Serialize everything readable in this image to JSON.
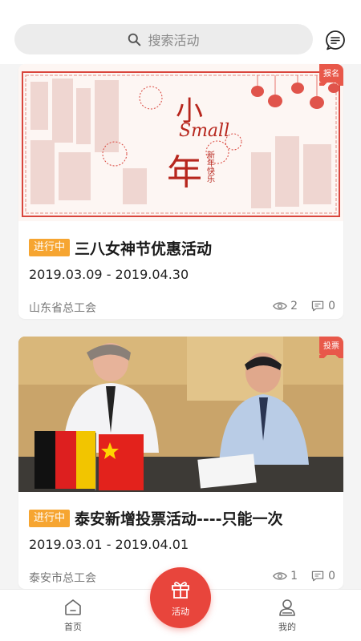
{
  "search": {
    "placeholder": "搜索活动"
  },
  "cards": [
    {
      "corner_tag": "报名",
      "status": "进行中",
      "title": "三八女神节优惠活动",
      "date_range": "2019.03.09  -  2019.04.30",
      "organizer": "山东省总工会",
      "views": "2",
      "comments": "0",
      "image_text": {
        "small": "Small",
        "xiao": "小",
        "nian": "年",
        "sub": "新年快乐"
      }
    },
    {
      "corner_tag": "投票",
      "status": "进行中",
      "title": "泰安新增投票活动----只能一次",
      "date_range": "2019.03.01  -  2019.04.01",
      "organizer": "泰安市总工会",
      "views": "1",
      "comments": "0"
    }
  ],
  "nav": {
    "home": "首页",
    "activity": "活动",
    "mine": "我的"
  },
  "colors": {
    "accent": "#e8453c",
    "status": "#f6a531"
  }
}
